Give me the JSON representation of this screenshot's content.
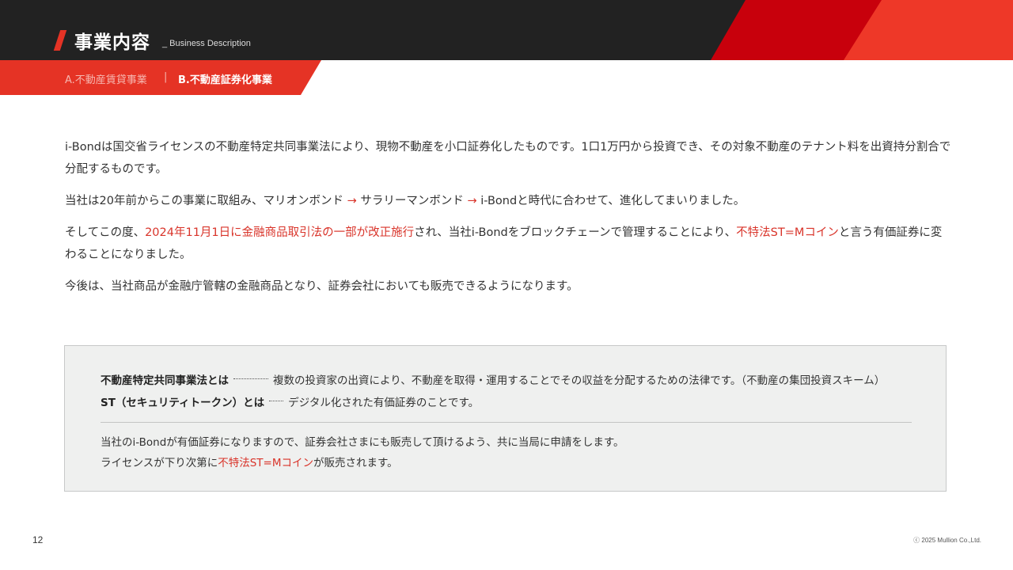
{
  "header": {
    "title": "事業内容",
    "subtitle": "_ Business Description",
    "colors": {
      "band": "#222222",
      "accent_red": "#c8000c",
      "accent_bright": "#ee3828"
    }
  },
  "tabs": [
    {
      "label": "A.不動産賃貸事業",
      "active": false
    },
    {
      "label": "B.不動産証券化事業",
      "active": true
    }
  ],
  "tab_separator": "|",
  "paragraphs": {
    "p1": "i-Bondは国交省ライセンスの不動産特定共同事業法により、現物不動産を小口証券化したものです。1口1万円から投資でき、その対象不動産のテナント料を出資持分割合で分配するものです。",
    "p2": {
      "a": "当社は20年前からこの事業に取組み、マリオンボンド ",
      "arrow1": "→",
      "b": " サラリーマンボンド ",
      "arrow2": "→",
      "c": " i-Bondと時代に合わせて、進化してまいりました。"
    },
    "p3": {
      "a": "そしてこの度、",
      "red1": "2024年11月1日に金融商品取引法の一部が改正施行",
      "b": "され、当社i-Bondをブロックチェーンで管理することにより、",
      "red2": "不特法ST=Mコイン",
      "c": "と言う有価証券に変わることになりました。"
    },
    "p4": "今後は、当社商品が金融庁管轄の金融商品となり、証券会社においても販売できるようになります。"
  },
  "notebox": {
    "definitions": [
      {
        "term": "不動産特定共同事業法とは",
        "desc": "複数の投資家の出資により、不動産を取得・運用することでその収益を分配するための法律です。（不動産の集団投資スキーム）"
      },
      {
        "term": "ST（セキュリティトークン）とは",
        "desc": "デジタル化された有価証券のことです。"
      }
    ],
    "line1": "当社のi-Bondが有価証券になりますので、証券会社さまにも販売して頂けるよう、共に当局に申請をします。",
    "line2": {
      "a": "ライセンスが下り次第に",
      "red": "不特法ST=Mコイン",
      "b": "が販売されます。"
    }
  },
  "footer": {
    "page_number": "12",
    "copyright": "ⓒ 2025 Mullion Co.,Ltd."
  },
  "colors": {
    "highlight_red": "#d9342a",
    "tab_bar": "#e53325",
    "notebox_bg": "#eff0ef"
  }
}
